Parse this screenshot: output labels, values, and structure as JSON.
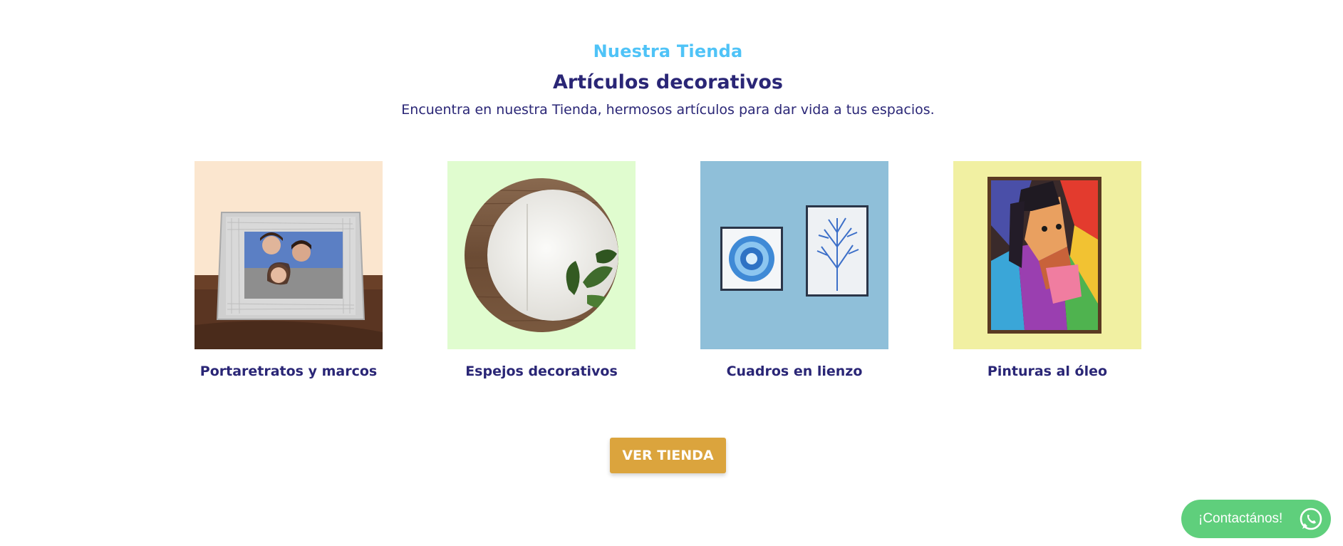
{
  "section": {
    "eyebrow": "Nuestra Tienda",
    "title": "Artículos decorativos",
    "subtitle": "Encuentra en nuestra Tienda, hermosos artículos para dar vida a tus espacios."
  },
  "products": [
    {
      "label": "Portaretratos y marcos",
      "icon": "photo-frame-image",
      "bg": "#fbe6cf"
    },
    {
      "label": "Espejos decorativos",
      "icon": "round-mirror-image",
      "bg": "#e0fccf"
    },
    {
      "label": "Cuadros en lienzo",
      "icon": "canvas-prints-image",
      "bg": "#8fbfd9"
    },
    {
      "label": "Pinturas al óleo",
      "icon": "oil-painting-image",
      "bg": "#f1f0a2"
    }
  ],
  "cta": {
    "label": "VER TIENDA",
    "color": "#dba43d"
  },
  "whatsapp": {
    "label": "¡Contactános!",
    "color": "#5fcf7c",
    "icon": "whatsapp-icon"
  },
  "colors": {
    "eyebrow": "#4fc3f7",
    "text": "#2a2676"
  }
}
